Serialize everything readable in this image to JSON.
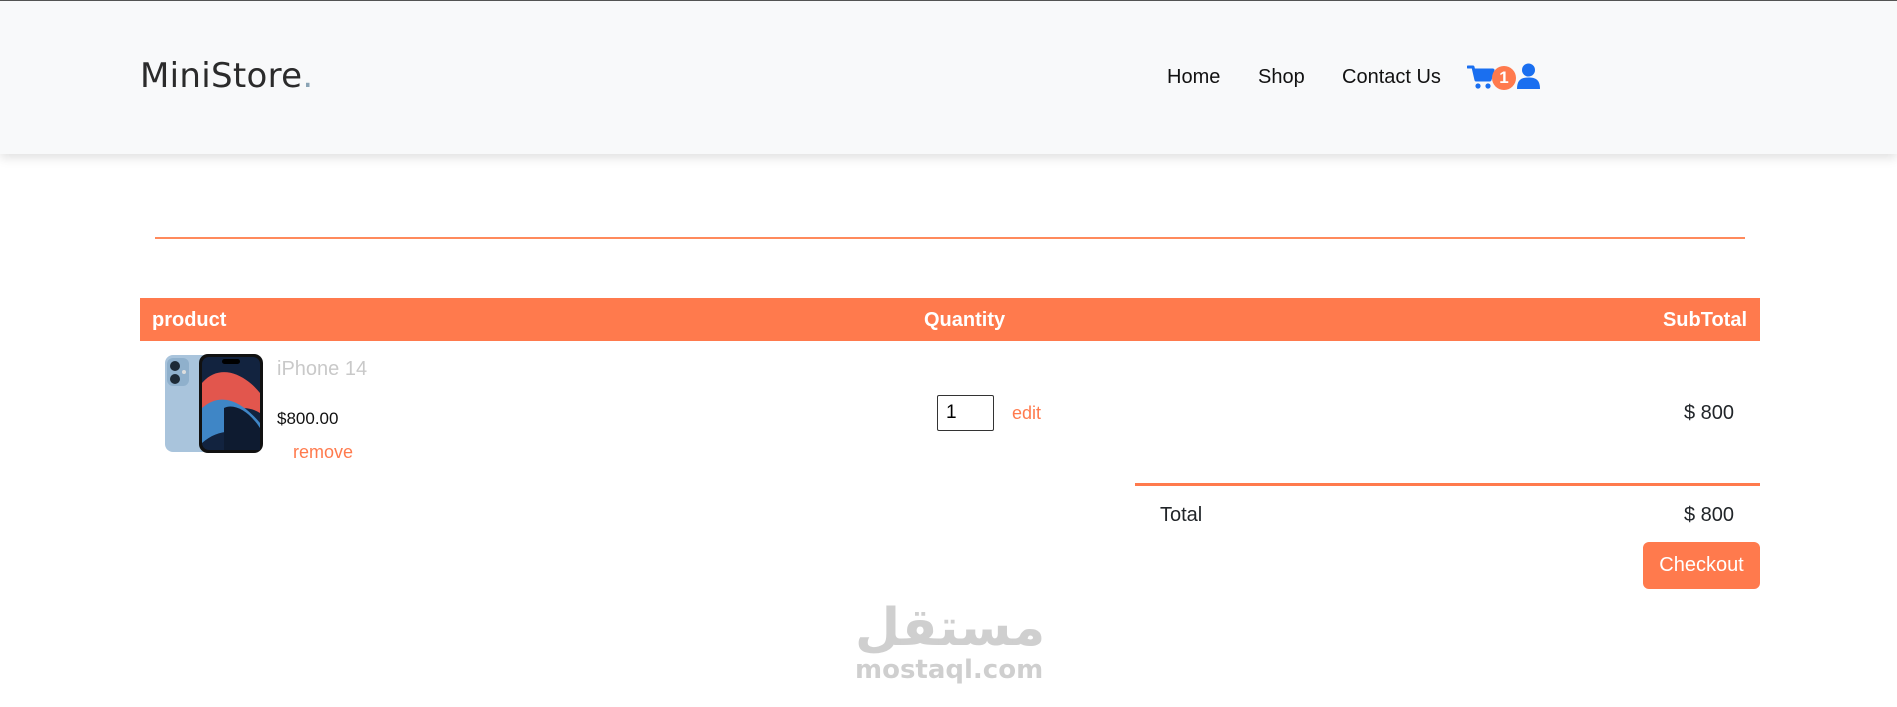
{
  "brand": {
    "name": "MiniStore",
    "dot": "."
  },
  "nav": {
    "links": [
      "Home",
      "Shop",
      "Contact Us"
    ],
    "cart_count": "1",
    "icons": [
      "cart-icon",
      "user-icon"
    ]
  },
  "cart_table": {
    "headers": {
      "product": "product",
      "quantity": "Quantity",
      "subtotal": "SubTotal"
    },
    "rows": [
      {
        "name": "iPhone 14",
        "price": "$800.00",
        "remove": "remove",
        "quantity": "1",
        "edit": "edit",
        "subtotal": "$ 800"
      }
    ]
  },
  "summary": {
    "total_label": "Total",
    "total_value": "$ 800",
    "checkout": "Checkout"
  },
  "watermark": {
    "arabic": "مستقل",
    "latin": "mostaql.com"
  },
  "colors": {
    "accent": "#ff7a4d",
    "icon_blue": "#1a6ff0",
    "navbar_bg": "#f8f9fa"
  }
}
